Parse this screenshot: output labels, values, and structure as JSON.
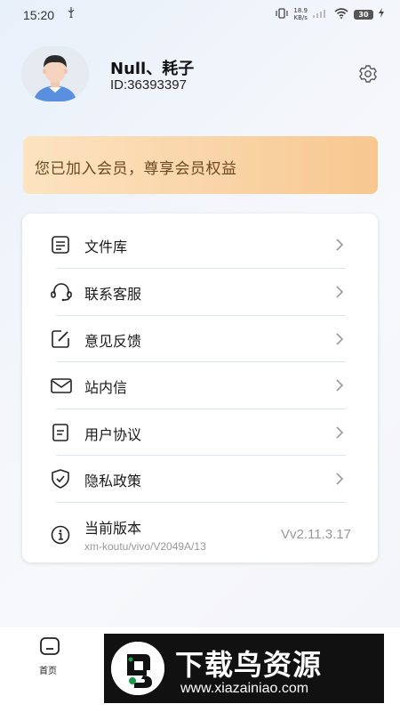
{
  "status_bar": {
    "time": "15:20",
    "net_speed_value": "18.9",
    "net_speed_unit": "KB/s",
    "battery_level": "30"
  },
  "profile": {
    "username": "Null、耗子",
    "user_id": "ID:36393397"
  },
  "member_banner": {
    "text": "您已加入会员，尊享会员权益"
  },
  "menu": {
    "items": [
      {
        "label": "文件库",
        "icon": "file-library-icon"
      },
      {
        "label": "联系客服",
        "icon": "headset-icon"
      },
      {
        "label": "意见反馈",
        "icon": "feedback-edit-icon"
      },
      {
        "label": "站内信",
        "icon": "mail-icon"
      },
      {
        "label": "用户协议",
        "icon": "document-icon"
      },
      {
        "label": "隐私政策",
        "icon": "shield-check-icon"
      }
    ],
    "version": {
      "label": "当前版本",
      "sub": "xm-koutu/vivo/V2049A/13",
      "value": "Vv2.11.3.17",
      "icon": "info-icon"
    }
  },
  "bottom_nav": {
    "home_label": "首页"
  },
  "watermark": {
    "title": "下载鸟资源",
    "url": "www.xiazainiao.com"
  },
  "colors": {
    "banner_start": "#fde3c1",
    "banner_end": "#f7c78f",
    "banner_text": "#6b4a21",
    "card_bg": "#ffffff",
    "divider": "#dde6f0"
  }
}
